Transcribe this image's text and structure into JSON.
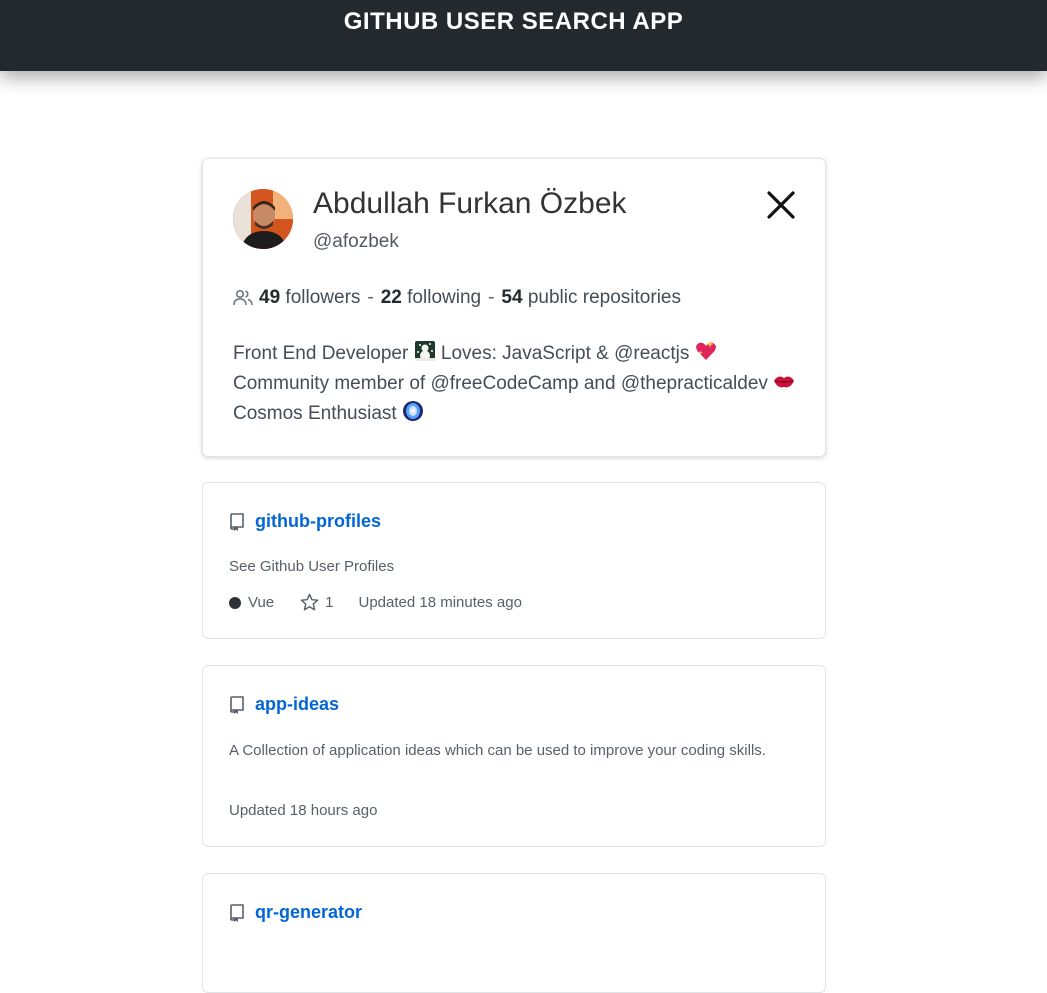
{
  "app": {
    "title": "GITHUB USER SEARCH APP"
  },
  "profile": {
    "name": "Abdullah Furkan Özbek",
    "login": "@afozbek",
    "followers_count": "49",
    "followers_label": "followers",
    "following_count": "22",
    "following_label": "following",
    "repos_count": "54",
    "repos_label": "public repositories",
    "stat_separator": "-",
    "bio_part1": "Front End Developer",
    "bio_part2": "Loves: JavaScript & @reactjs",
    "bio_part3": "Community member of @freeCodeCamp and @thepracticaldev",
    "bio_part4": "Cosmos Enthusiast"
  },
  "repos": [
    {
      "name": "github-profiles",
      "description": "See Github User Profiles",
      "language": "Vue",
      "language_color": "#2b3137",
      "stars": "1",
      "updated": "Updated 18 minutes ago"
    },
    {
      "name": "app-ideas",
      "description": "A Collection of application ideas which can be used to improve your coding skills.",
      "updated": "Updated 18 hours ago"
    },
    {
      "name": "qr-generator"
    }
  ],
  "colors": {
    "header_bg": "#24292e",
    "link": "#0366d6"
  }
}
